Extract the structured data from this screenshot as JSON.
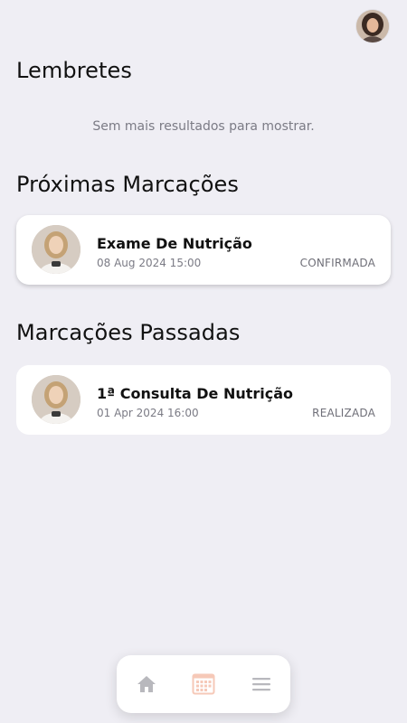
{
  "user": {
    "avatar_icon": "user-avatar-photo"
  },
  "reminders": {
    "title": "Lembretes",
    "empty_message": "Sem mais resultados para mostrar."
  },
  "upcoming": {
    "title": "Próximas Marcações",
    "items": [
      {
        "title": "Exame De Nutrição",
        "datetime": "08 Aug 2024 15:00",
        "status": "CONFIRMADA"
      }
    ]
  },
  "past": {
    "title": "Marcações Passadas",
    "items": [
      {
        "title": "1ª Consulta De Nutrição",
        "datetime": "01 Apr 2024 16:00",
        "status": "REALIZADA"
      }
    ]
  },
  "bottom_nav": {
    "items": [
      {
        "icon": "home-icon",
        "active": false
      },
      {
        "icon": "calendar-icon",
        "active": true
      },
      {
        "icon": "menu-icon",
        "active": false
      }
    ],
    "active_color": "#f6c9b8",
    "inactive_color": "#b8b8bd"
  }
}
